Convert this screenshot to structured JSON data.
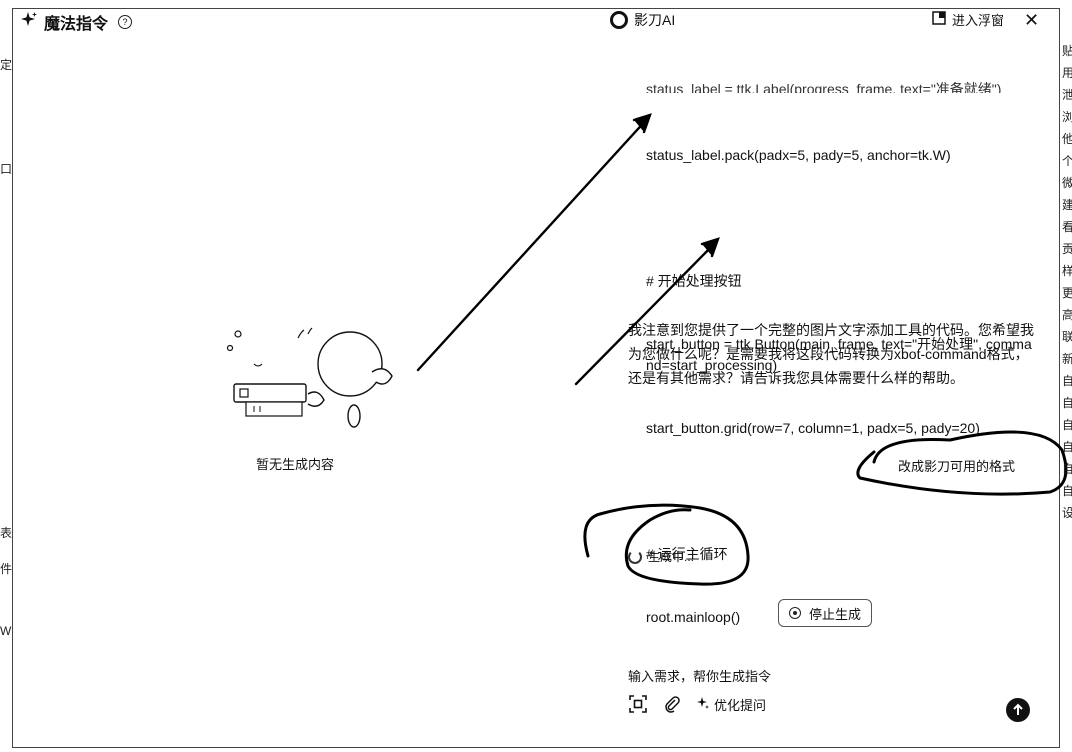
{
  "left_panel": {
    "title": "魔法指令",
    "empty_text": "暂无生成内容"
  },
  "right_panel": {
    "brand": "影刀AI",
    "float_button": "进入浮窗",
    "code_cut_line": "status_label = ttk.Label(progress_frame, text=\"准备就绪\")",
    "code_lines": [
      "status_label.pack(padx=5, pady=5, anchor=tk.W)",
      "",
      "# 开始处理按钮",
      "start_button = ttk.Button(main_frame, text=\"开始处理\", command=start_processing)",
      "start_button.grid(row=7, column=1, padx=5, pady=20)",
      "",
      "# 运行主循环",
      "root.mainloop()"
    ],
    "assistant_message": "我注意到您提供了一个完整的图片文字添加工具的代码。您希望我为您做什么呢？是需要我将这段代码转换为xbot-command格式，还是有其他需求？请告诉我您具体需要什么样的帮助。",
    "user_message": "改成影刀可用的格式",
    "generating_text": "生成中...",
    "stop_button": "停止生成",
    "input_placeholder": "输入需求，帮你生成指令",
    "optimize_label": "优化提问"
  },
  "edge_text": {
    "left": [
      "定",
      "口",
      "表",
      "件",
      "W"
    ],
    "right": "贴用泄浏他个微建看贡样更高联新自自自自自自设"
  },
  "icons": {
    "sparkle": "sparkle-icon",
    "help": "help-icon",
    "brand": "brand-ring-icon",
    "float": "float-window-icon",
    "close": "close-icon",
    "screenshot": "screenshot-icon",
    "attach": "paperclip-icon",
    "send": "send-arrow-icon"
  }
}
